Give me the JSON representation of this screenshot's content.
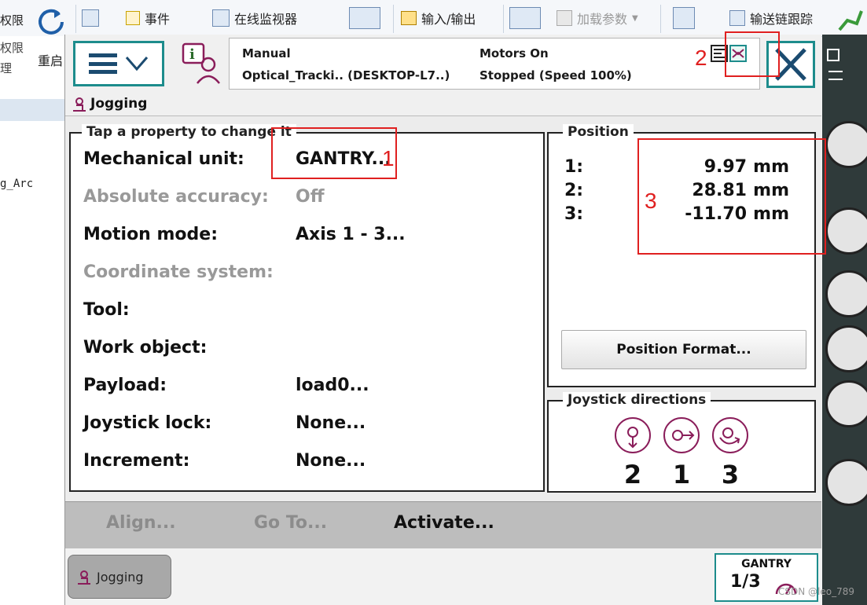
{
  "host_toolbar": {
    "left_labels": [
      "权限",
      "权限",
      "理"
    ],
    "restart_label": "重启",
    "events_label": "事件",
    "online_monitor_label": "在线监视器",
    "io_label": "输入/输出",
    "load_params_label": "加载参数",
    "conveyor_label": "输送链跟踪"
  },
  "host_left": {
    "tree_item": "g_Arc"
  },
  "header": {
    "mode": "Manual",
    "controller": "Optical_Tracki.. (DESKTOP-L7..)",
    "motors": "Motors On",
    "state": "Stopped (Speed 100%)"
  },
  "title": "Jogging",
  "properties": {
    "legend": "Tap a property to change it",
    "rows": [
      {
        "key": "Mechanical unit:",
        "value": "GANTRY..."
      },
      {
        "key": "Absolute accuracy:",
        "value": "Off"
      },
      {
        "key": "Motion mode:",
        "value": "Axis 1 - 3..."
      },
      {
        "key": "Coordinate system:",
        "value": ""
      },
      {
        "key": "Tool:",
        "value": ""
      },
      {
        "key": "Work object:",
        "value": ""
      },
      {
        "key": "Payload:",
        "value": "load0..."
      },
      {
        "key": "Joystick lock:",
        "value": "None..."
      },
      {
        "key": "Increment:",
        "value": "None..."
      }
    ]
  },
  "position": {
    "legend": "Position",
    "rows": [
      {
        "index": "1:",
        "value": "9.97",
        "unit": "mm"
      },
      {
        "index": "2:",
        "value": "28.81",
        "unit": "mm"
      },
      {
        "index": "3:",
        "value": "-11.70",
        "unit": "mm"
      }
    ],
    "format_button": "Position Format..."
  },
  "joystick": {
    "legend": "Joystick directions",
    "numbers": [
      "2",
      "1",
      "3"
    ]
  },
  "commands": {
    "align": "Align...",
    "goto": "Go To...",
    "activate": "Activate..."
  },
  "taskbar": {
    "jogging": "Jogging",
    "unit": "GANTRY",
    "fraction": "1/3"
  },
  "annotations": [
    "1",
    "2",
    "3"
  ],
  "watermark": "CSDN @leo_789",
  "colors": {
    "accent": "#1d8c8c",
    "annotation": "#e02020",
    "joystick_icon": "#8a1d5a"
  }
}
